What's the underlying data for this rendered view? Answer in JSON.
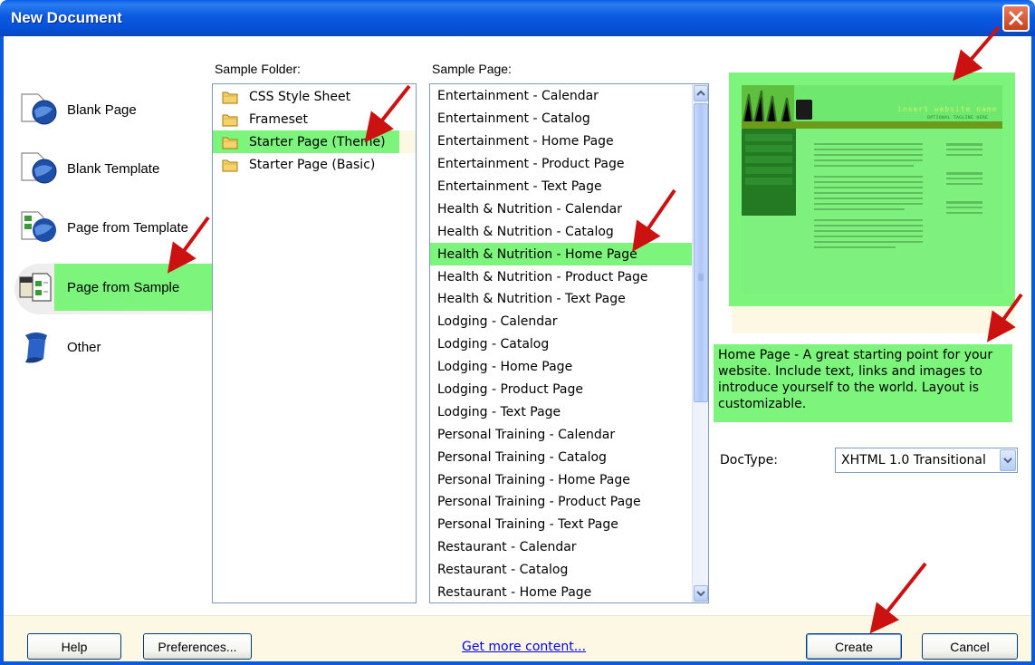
{
  "window": {
    "title": "New Document",
    "close_label": "×"
  },
  "categories": [
    {
      "label": "Blank Page",
      "icon": "blank-page-icon"
    },
    {
      "label": "Blank Template",
      "icon": "blank-template-icon"
    },
    {
      "label": "Page from Template",
      "icon": "page-from-template-icon"
    },
    {
      "label": "Page from Sample",
      "icon": "page-from-sample-icon",
      "selected": true
    },
    {
      "label": "Other",
      "icon": "other-icon"
    }
  ],
  "sample_folder": {
    "label": "Sample Folder:",
    "items": [
      {
        "label": "CSS Style Sheet"
      },
      {
        "label": "Frameset"
      },
      {
        "label": "Starter Page (Theme)",
        "selected": true
      },
      {
        "label": "Starter Page (Basic)"
      }
    ]
  },
  "sample_page": {
    "label": "Sample Page:",
    "items": [
      "Entertainment - Calendar",
      "Entertainment - Catalog",
      "Entertainment - Home Page",
      "Entertainment - Product Page",
      "Entertainment - Text Page",
      "Health & Nutrition - Calendar",
      "Health & Nutrition - Catalog",
      "Health & Nutrition - Home Page",
      "Health & Nutrition - Product Page",
      "Health & Nutrition - Text Page",
      "Lodging - Calendar",
      "Lodging - Catalog",
      "Lodging - Home Page",
      "Lodging - Product Page",
      "Lodging - Text Page",
      "Personal Training - Calendar",
      "Personal Training - Catalog",
      "Personal Training - Home Page",
      "Personal Training - Product Page",
      "Personal Training - Text Page",
      "Restaurant - Calendar",
      "Restaurant - Catalog",
      "Restaurant - Home Page"
    ],
    "selected_index": 7
  },
  "preview": {
    "site_name": "insert website name",
    "tagline": "OPTIONAL TAGLINE HERE"
  },
  "description": "Home Page - A great starting point for your website. Include text, links and images to introduce yourself to the world. Layout is customizable.",
  "doctype": {
    "label": "DocType:",
    "value": "XHTML 1.0 Transitional"
  },
  "footer": {
    "help": "Help",
    "preferences": "Preferences...",
    "get_more": "Get more content...",
    "create": "Create",
    "cancel": "Cancel"
  },
  "colors": {
    "highlight": "#7df57d",
    "titlebar": "#0a5ae0",
    "annotation_arrow": "#cc1111"
  }
}
